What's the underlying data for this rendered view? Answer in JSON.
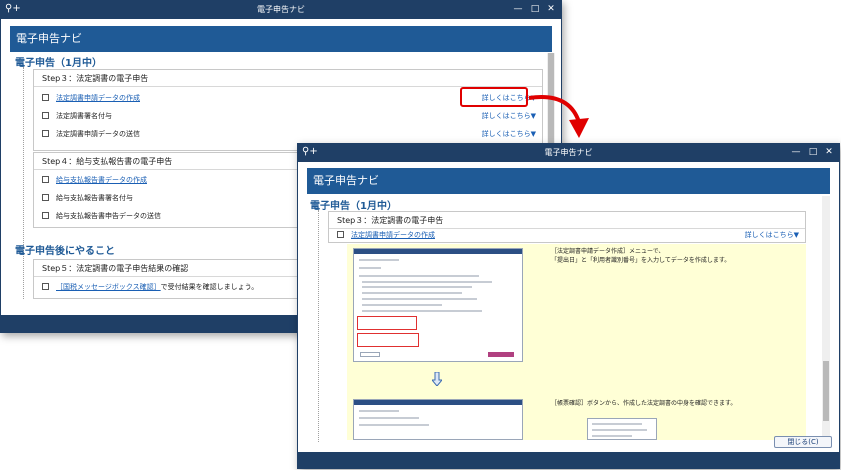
{
  "window_title": "電子申告ナビ",
  "header_title": "電子申告ナビ",
  "section1_title": "電子申告（1月中）",
  "section2_title": "電子申告後にやること",
  "more_label": "詳しくはこちら▼",
  "close_label": "閉じる(C)",
  "step3": {
    "title": "Step３：法定調書の電子申告",
    "items": [
      {
        "label": "法定調書申請データの作成"
      },
      {
        "label": "法定調書署名付与"
      },
      {
        "label": "法定調書申請データの送信"
      }
    ]
  },
  "step4": {
    "title": "Step４：給与支払報告書の電子申告",
    "items": [
      {
        "label": "給与支払報告書データの作成"
      },
      {
        "label": "給与支払報告書署名付与"
      },
      {
        "label": "給与支払報告書申告データの送信"
      }
    ]
  },
  "step5": {
    "title": "Step５：法定調書の電子申告結果の確認",
    "item_link": "［国税メッセージボックス確認］",
    "item_rest": "で受付結果を確認しましょう。"
  },
  "detail": {
    "desc1_line1": "［法定調書申請データ作成］メニューで、",
    "desc1_line2": "「提出日」と「利用者識別番号」を入力してデータを作成します。",
    "desc2": "［帳票確認］ボタンから、作成した法定調書の中身を確認できます。"
  },
  "colors": {
    "titlebar": "#1f3f66",
    "header": "#1f5a96",
    "link": "#1a5fb4",
    "highlight": "#e00000",
    "detail_bg": "#ffffd6"
  }
}
